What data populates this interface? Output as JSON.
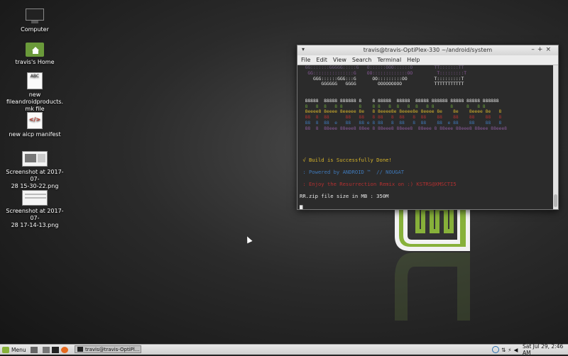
{
  "desktop": {
    "icons": [
      {
        "label": "Computer",
        "icon": "monitor-icon"
      },
      {
        "label": "travis's Home",
        "icon": "home-folder-icon"
      },
      {
        "label": "new fileandroidproducts.mk file",
        "label_lines": [
          "new",
          "fileandroidproducts.",
          "mk file"
        ],
        "icon": "text-file-icon",
        "badge": "ABC"
      },
      {
        "label": "new aicp manifest",
        "icon": "html-file-icon",
        "badge": "</>"
      },
      {
        "label": "Screenshot at 2017-07-28 15-30-22.png",
        "label_lines": [
          "Screenshot at 2017-07-",
          "28 15-30-22.png"
        ],
        "icon": "image-file-icon"
      },
      {
        "label": "Screenshot at 2017-07-28 17-14-13.png",
        "label_lines": [
          "Screenshot at 2017-07-",
          "28 17-14-13.png"
        ],
        "icon": "image-file-icon"
      }
    ]
  },
  "terminal": {
    "title": "travis@travis-OptiPlex-330 ~/android/system",
    "menu": [
      "File",
      "Edit",
      "View",
      "Search",
      "Terminal",
      "Help"
    ],
    "lines": [
      {
        "text": "  GG:::::::GGGGG:::::G   O::::::OOO::::::O        TT:::::::TT",
        "color": "#6a5a7a"
      },
      {
        "text": "   GG:::::::::::::::G    OO:::::::::::::OO         T:::::::::T",
        "color": "#8a5a9a"
      },
      {
        "text": "     GGG::::::GGG:::G      OO:::::::::OO          T:::::::::T",
        "color": "#e8e8e8"
      },
      {
        "text": "        GGGGGG   GGGG        OOOOOOOOO            TTTTTTTTTTT",
        "color": "#e8e8e8"
      },
      {
        "text": "",
        "color": "#e8e8e8"
      },
      {
        "text": "",
        "color": "#e8e8e8"
      },
      {
        "text": "  88888  88888 888888 8    8 88888  88888  88888 888888 88888 88888 888888",
        "color": "#e8e8e8"
      },
      {
        "text": "  8   8  8   8 8      8    8 8   8  8   8  8   8 8      8     8   8 8",
        "color": "#6aa13a"
      },
      {
        "text": "  8eeee8 8eeee 8eeeee 8e   8 8eeee8e 8eeee8e 8eeee 8e    8e    8eeee 8e   8",
        "color": "#d7b52b"
      },
      {
        "text": "  88  8  88      88   88   8 88   8  88   8  88    88    88    88    88   8",
        "color": "#b33030"
      },
      {
        "text": "  88  8  88  e   88   88 e 8 88   8  88   8  88    88  e 88    88    88   8",
        "color": "#3f78b8"
      },
      {
        "text": "  88  8  88eee 88eee8 88ee 8 88eee8 88eee8  88eee 8 88eee 88eee8 88eee 88eee8",
        "color": "#8a5a9a"
      },
      {
        "text": "",
        "color": "#e8e8e8"
      },
      {
        "text": "",
        "color": "#e8e8e8"
      },
      {
        "text": "",
        "color": "#e8e8e8"
      },
      {
        "text": "",
        "color": "#e8e8e8"
      },
      {
        "text": " √ Build is Successfully Done!",
        "color": "#d7b52b",
        "big": true
      },
      {
        "text": " : Powered by ANDROID ™  // NOUGAT",
        "color": "#3f78b8",
        "big": true
      },
      {
        "text": " : Enjoy the Resurrection Remix on :) KSTRS@XMSCTI5",
        "color": "#b33030",
        "big": true
      },
      {
        "text": "RR.zip file size in MB : 350M",
        "color": "#e8e8e8",
        "big": true
      },
      {
        "text": "█",
        "color": "#e8e8e8",
        "big": true
      }
    ]
  },
  "taskbar": {
    "menu_label": "Menu",
    "task_label": "travis@travis-OptiPl...",
    "clock": "Sat Jul 29,  2:46 AM"
  },
  "colors": {
    "mint_green": "#87b13a",
    "mint_dark": "#4d7a22"
  }
}
